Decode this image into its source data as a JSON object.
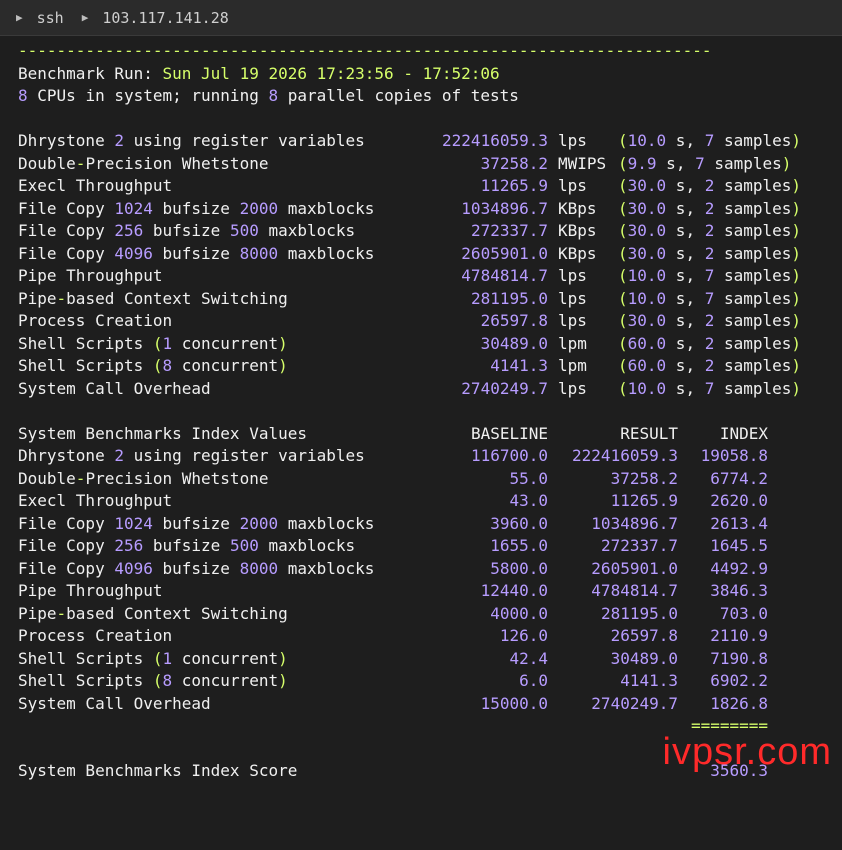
{
  "tabbar": {
    "icon1": "triangle-right-icon",
    "seg1": "ssh",
    "icon2": "triangle-right-icon",
    "seg2": "103.117.141.28"
  },
  "header": {
    "dashes": "------------------------------------------------------------------------",
    "run_label": "Benchmark Run:",
    "run_value": "Sun Jul 19 2026 17:23:56 - 17:52:06",
    "cpus_num": "8",
    "cpus_text1": " CPUs in system; running ",
    "cpus_num2": "8",
    "cpus_text2": " parallel copies of tests"
  },
  "results": [
    {
      "name": "Dhrystone 2 using register variables",
      "value": "222416059.3",
      "unit": "lps",
      "time": "10.0",
      "samples": "7"
    },
    {
      "name": "Double-Precision Whetstone",
      "value": "37258.2",
      "unit": "MWIPS",
      "time": "9.9",
      "samples": "7"
    },
    {
      "name": "Execl Throughput",
      "value": "11265.9",
      "unit": "lps",
      "time": "30.0",
      "samples": "2"
    },
    {
      "name": "File Copy 1024 bufsize 2000 maxblocks",
      "value": "1034896.7",
      "unit": "KBps",
      "time": "30.0",
      "samples": "2"
    },
    {
      "name": "File Copy 256 bufsize 500 maxblocks",
      "value": "272337.7",
      "unit": "KBps",
      "time": "30.0",
      "samples": "2"
    },
    {
      "name": "File Copy 4096 bufsize 8000 maxblocks",
      "value": "2605901.0",
      "unit": "KBps",
      "time": "30.0",
      "samples": "2"
    },
    {
      "name": "Pipe Throughput",
      "value": "4784814.7",
      "unit": "lps",
      "time": "10.0",
      "samples": "7"
    },
    {
      "name": "Pipe-based Context Switching",
      "value": "281195.0",
      "unit": "lps",
      "time": "10.0",
      "samples": "7"
    },
    {
      "name": "Process Creation",
      "value": "26597.8",
      "unit": "lps",
      "time": "30.0",
      "samples": "2"
    },
    {
      "name": "Shell Scripts (1 concurrent)",
      "value": "30489.0",
      "unit": "lpm",
      "time": "60.0",
      "samples": "2"
    },
    {
      "name": "Shell Scripts (8 concurrent)",
      "value": "4141.3",
      "unit": "lpm",
      "time": "60.0",
      "samples": "2"
    },
    {
      "name": "System Call Overhead",
      "value": "2740249.7",
      "unit": "lps",
      "time": "10.0",
      "samples": "7"
    }
  ],
  "results_suffix": {
    "s": " s, ",
    "samples": " samples)"
  },
  "index_header": {
    "title": "System Benchmarks Index Values",
    "baseline": "BASELINE",
    "result": "RESULT",
    "index": "INDEX"
  },
  "index_rows": [
    {
      "name": "Dhrystone 2 using register variables",
      "baseline": "116700.0",
      "result": "222416059.3",
      "index": "19058.8"
    },
    {
      "name": "Double-Precision Whetstone",
      "baseline": "55.0",
      "result": "37258.2",
      "index": "6774.2"
    },
    {
      "name": "Execl Throughput",
      "baseline": "43.0",
      "result": "11265.9",
      "index": "2620.0"
    },
    {
      "name": "File Copy 1024 bufsize 2000 maxblocks",
      "baseline": "3960.0",
      "result": "1034896.7",
      "index": "2613.4"
    },
    {
      "name": "File Copy 256 bufsize 500 maxblocks",
      "baseline": "1655.0",
      "result": "272337.7",
      "index": "1645.5"
    },
    {
      "name": "File Copy 4096 bufsize 8000 maxblocks",
      "baseline": "5800.0",
      "result": "2605901.0",
      "index": "4492.9"
    },
    {
      "name": "Pipe Throughput",
      "baseline": "12440.0",
      "result": "4784814.7",
      "index": "3846.3"
    },
    {
      "name": "Pipe-based Context Switching",
      "baseline": "4000.0",
      "result": "281195.0",
      "index": "703.0"
    },
    {
      "name": "Process Creation",
      "baseline": "126.0",
      "result": "26597.8",
      "index": "2110.9"
    },
    {
      "name": "Shell Scripts (1 concurrent)",
      "baseline": "42.4",
      "result": "30489.0",
      "index": "7190.8"
    },
    {
      "name": "Shell Scripts (8 concurrent)",
      "baseline": "6.0",
      "result": "4141.3",
      "index": "6902.2"
    },
    {
      "name": "System Call Overhead",
      "baseline": "15000.0",
      "result": "2740249.7",
      "index": "1826.8"
    }
  ],
  "score": {
    "separator": "========",
    "label": "System Benchmarks Index Score",
    "value": "3560.3"
  },
  "watermark": "ivpsr.com",
  "colors": {
    "number": "#b79cff",
    "accent": "#d6ff6a",
    "watermark": "#ff2a2a",
    "background": "#1e1e1e"
  }
}
